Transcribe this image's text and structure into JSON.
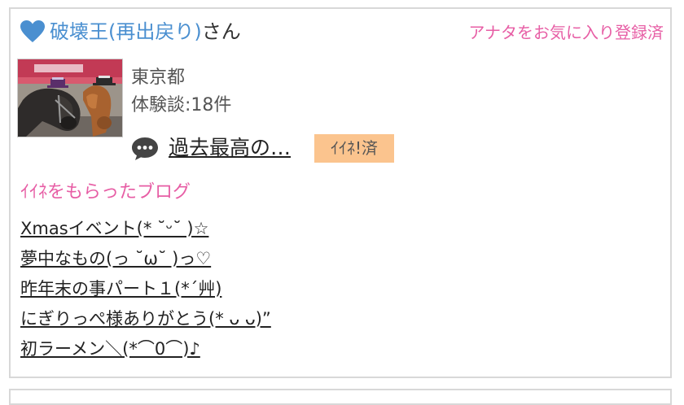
{
  "colors": {
    "accent_pink": "#e75ea5",
    "link_blue": "#4a8fd0",
    "badge_orange": "#fbc48e"
  },
  "header": {
    "icon": "heart-icon",
    "user_name": "破壊王(再出戻り)",
    "honorific": "さん",
    "favorite_status": "アナタをお気に入り登録済"
  },
  "profile": {
    "avatar": "horses-photo",
    "location": "東京都",
    "experience_count": "体験談:18件"
  },
  "review": {
    "icon": "chat-bubble-icon",
    "title": "過去最高の…",
    "iine_badge": "ｲｲﾈ!済"
  },
  "blogs": {
    "section_title": "ｲｲﾈをもらったブログ",
    "items": [
      {
        "title": "Xmasイベント(* ˘ᵕ˘ )☆"
      },
      {
        "title": "夢中なもの(っ ˘ω˘ )っ♡"
      },
      {
        "title": "昨年末の事パート１(*´艸)"
      },
      {
        "title": "にぎりっぺ様ありがとう(* ᴗ ᴗ)”"
      },
      {
        "title": "初ラーメン＼(*⌒0⌒)♪"
      }
    ]
  }
}
